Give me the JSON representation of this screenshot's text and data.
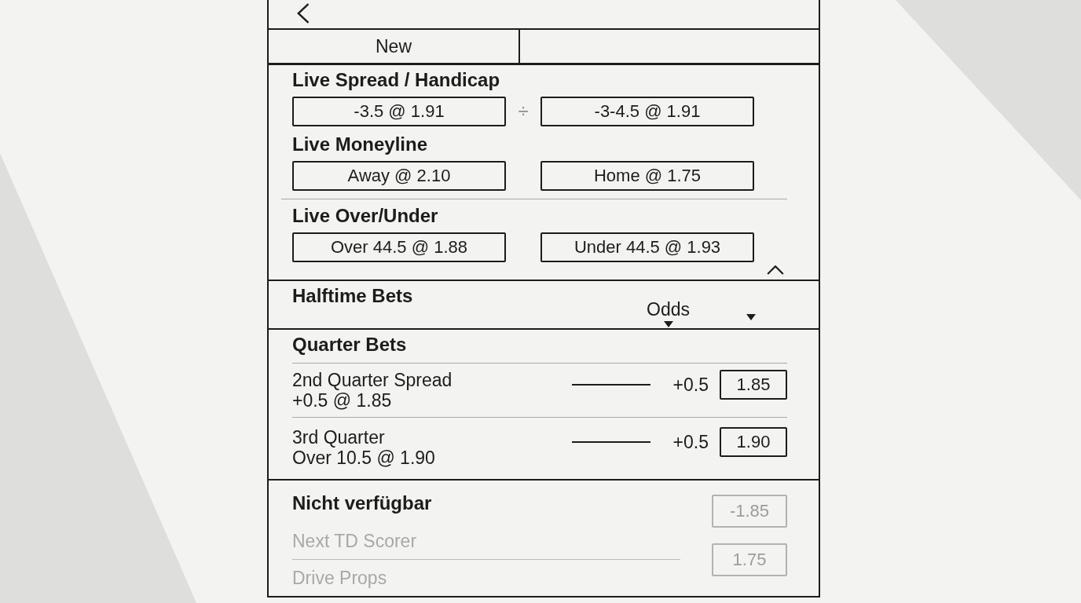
{
  "new_button": {
    "label": "New"
  },
  "live": {
    "expanded": true,
    "markets": [
      {
        "title": "Live Spread / Handicap",
        "separator": "÷",
        "options": [
          {
            "label": "-3.5 @ 1.91"
          },
          {
            "label": "-3-4.5 @ 1.91"
          }
        ]
      },
      {
        "title": "Live Moneyline",
        "options": [
          {
            "label": "Away @ 2.10"
          },
          {
            "label": "Home @ 1.75"
          }
        ]
      },
      {
        "title": "Live Over/Under",
        "divider_above": true,
        "options": [
          {
            "label": "Over 44.5 @ 1.88"
          },
          {
            "label": "Under 44.5 @ 1.93"
          }
        ]
      }
    ]
  },
  "halftime": {
    "title": "Halftime Bets",
    "dropdown": {
      "label": "Odds"
    }
  },
  "quarter": {
    "title": "Quarter Bets",
    "rows": [
      {
        "name": "2nd Quarter Spread",
        "selection": "+0.5 @ 1.85",
        "handicap": "+0.5",
        "odds": "1.85"
      },
      {
        "name": "3rd Quarter",
        "selection": "Over 10.5 @ 1.90",
        "handicap": "+0.5",
        "odds": "1.90"
      }
    ]
  },
  "unavailable": {
    "title": "Nicht verfügbar",
    "items": [
      {
        "name": "Next TD Scorer",
        "disabled": true
      },
      {
        "name": "Drive Props",
        "disabled": true
      }
    ],
    "odds": [
      {
        "label": "-1.85",
        "disabled": true
      },
      {
        "label": "1.75",
        "disabled": true
      }
    ]
  }
}
